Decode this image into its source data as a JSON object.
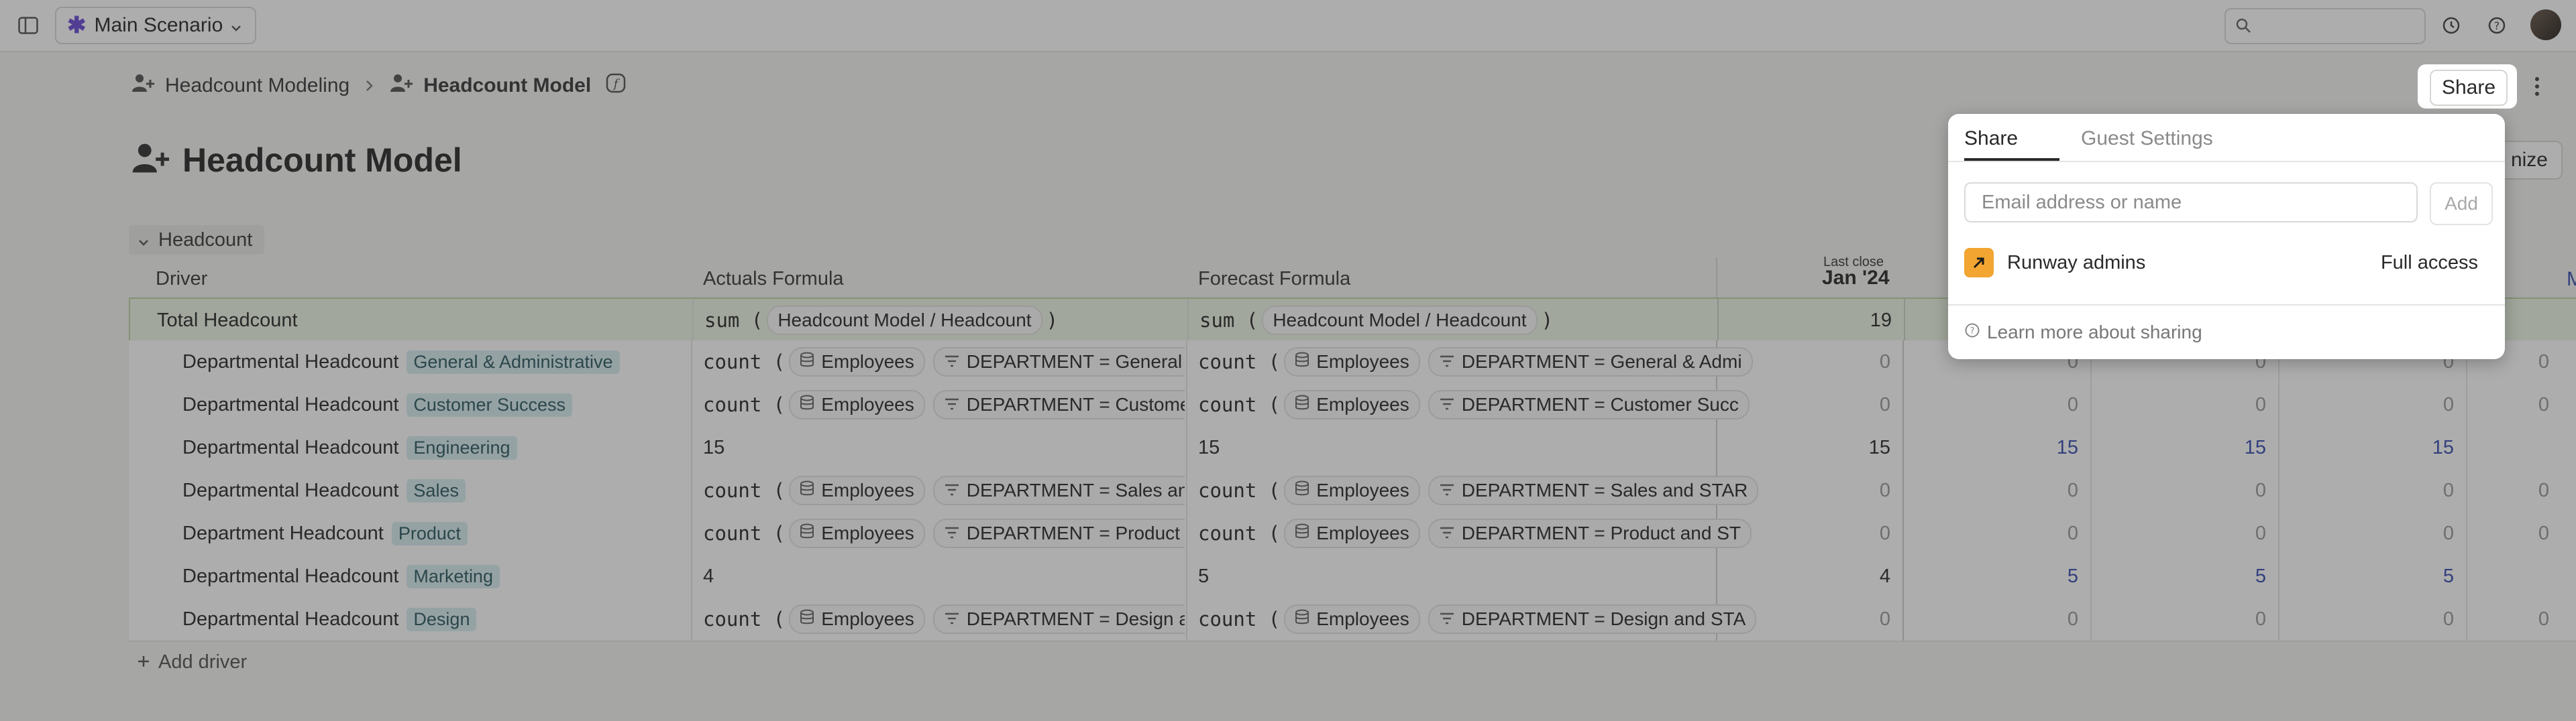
{
  "topbar": {
    "scenario_label": "Main Scenario",
    "search_placeholder": ""
  },
  "breadcrumb": {
    "parent": "Headcount Modeling",
    "current": "Headcount Model"
  },
  "page": {
    "title": "Headcount Model",
    "share_label": "Share",
    "customize_partial": "nize"
  },
  "section": {
    "label": "Headcount"
  },
  "columns": {
    "driver": "Driver",
    "actuals": "Actuals Formula",
    "forecast": "Forecast Formula",
    "last_close_label": "Last close",
    "month_first": "Jan '24",
    "month_clipped": "M"
  },
  "rows": [
    {
      "name": "Total Headcount",
      "tag": "",
      "actuals": {
        "fn": "sum (",
        "chip": "Headcount Model / Headcount",
        "close": ")"
      },
      "forecast": {
        "fn": "sum (",
        "chip": "Headcount Model / Headcount",
        "close": ")"
      },
      "values": [
        "19",
        "",
        "",
        "",
        ""
      ]
    },
    {
      "name": "Departmental Headcount",
      "tag": "General & Administrative",
      "actuals": {
        "fn": "count (",
        "src": "Employees",
        "filter": "DEPARTMENT = General & A"
      },
      "forecast": {
        "fn": "count (",
        "src": "Employees",
        "filter": "DEPARTMENT = General & Admi"
      },
      "values": [
        "0",
        "0",
        "0",
        "0",
        "0"
      ]
    },
    {
      "name": "Departmental Headcount",
      "tag": "Customer Success",
      "actuals": {
        "fn": "count (",
        "src": "Employees",
        "filter": "DEPARTMENT = Customer S"
      },
      "forecast": {
        "fn": "count (",
        "src": "Employees",
        "filter": "DEPARTMENT = Customer Succ"
      },
      "values": [
        "0",
        "0",
        "0",
        "0",
        "0"
      ]
    },
    {
      "name": "Departmental Headcount",
      "tag": "Engineering",
      "actuals": {
        "value": "15"
      },
      "forecast": {
        "value": "15"
      },
      "values": [
        "15",
        "15",
        "15",
        "15",
        ""
      ]
    },
    {
      "name": "Departmental Headcount",
      "tag": "Sales",
      "actuals": {
        "fn": "count (",
        "src": "Employees",
        "filter": "DEPARTMENT = Sales and S"
      },
      "forecast": {
        "fn": "count (",
        "src": "Employees",
        "filter": "DEPARTMENT = Sales and STAR"
      },
      "values": [
        "0",
        "0",
        "0",
        "0",
        "0"
      ]
    },
    {
      "name": "Department Headcount",
      "tag": "Product",
      "actuals": {
        "fn": "count (",
        "src": "Employees",
        "filter": "DEPARTMENT = Product and"
      },
      "forecast": {
        "fn": "count (",
        "src": "Employees",
        "filter": "DEPARTMENT = Product and ST"
      },
      "values": [
        "0",
        "0",
        "0",
        "0",
        "0"
      ]
    },
    {
      "name": "Departmental Headcount",
      "tag": "Marketing",
      "actuals": {
        "value": "4"
      },
      "forecast": {
        "value": "5"
      },
      "values": [
        "4",
        "5",
        "5",
        "5",
        ""
      ]
    },
    {
      "name": "Departmental Headcount",
      "tag": "Design",
      "actuals": {
        "fn": "count (",
        "src": "Employees",
        "filter": "DEPARTMENT = Design and"
      },
      "forecast": {
        "fn": "count (",
        "src": "Employees",
        "filter": "DEPARTMENT = Design and STA"
      },
      "values": [
        "0",
        "0",
        "0",
        "0",
        "0"
      ]
    }
  ],
  "add_driver_label": "Add driver",
  "share_popover": {
    "tab_share": "Share",
    "tab_guest": "Guest Settings",
    "email_placeholder": "Email address or name",
    "add_label": "Add",
    "member_name": "Runway admins",
    "member_access": "Full access",
    "learn_more": "Learn more about sharing"
  },
  "colors": {
    "accent_purple": "#6b4cd6",
    "runway_orange": "#f2a531",
    "tag_bg": "#d9eef0",
    "total_row_bg": "#eef5e6"
  }
}
